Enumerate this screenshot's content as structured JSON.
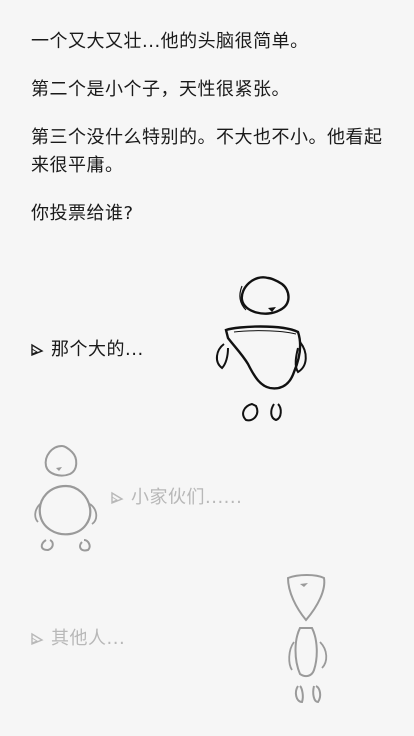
{
  "narrative": {
    "lines": [
      "一个又大又壮...他的头脑很简单。",
      "第二个是小个子，天性很紧张。",
      "第三个没什么特别的。不大也不小。他看起来很平庸。",
      "你投票给谁?"
    ]
  },
  "choices": [
    {
      "label": "那个大的...",
      "state": "active"
    },
    {
      "label": "小家伙们......",
      "state": "dim"
    },
    {
      "label": "其他人...",
      "state": "dim"
    }
  ],
  "figures": {
    "big": {
      "icon": "big-character-icon",
      "color": "#111111"
    },
    "small": {
      "icon": "small-character-icon",
      "color": "#9a9a9a"
    },
    "other": {
      "icon": "other-character-icon",
      "color": "#9a9a9a"
    }
  }
}
